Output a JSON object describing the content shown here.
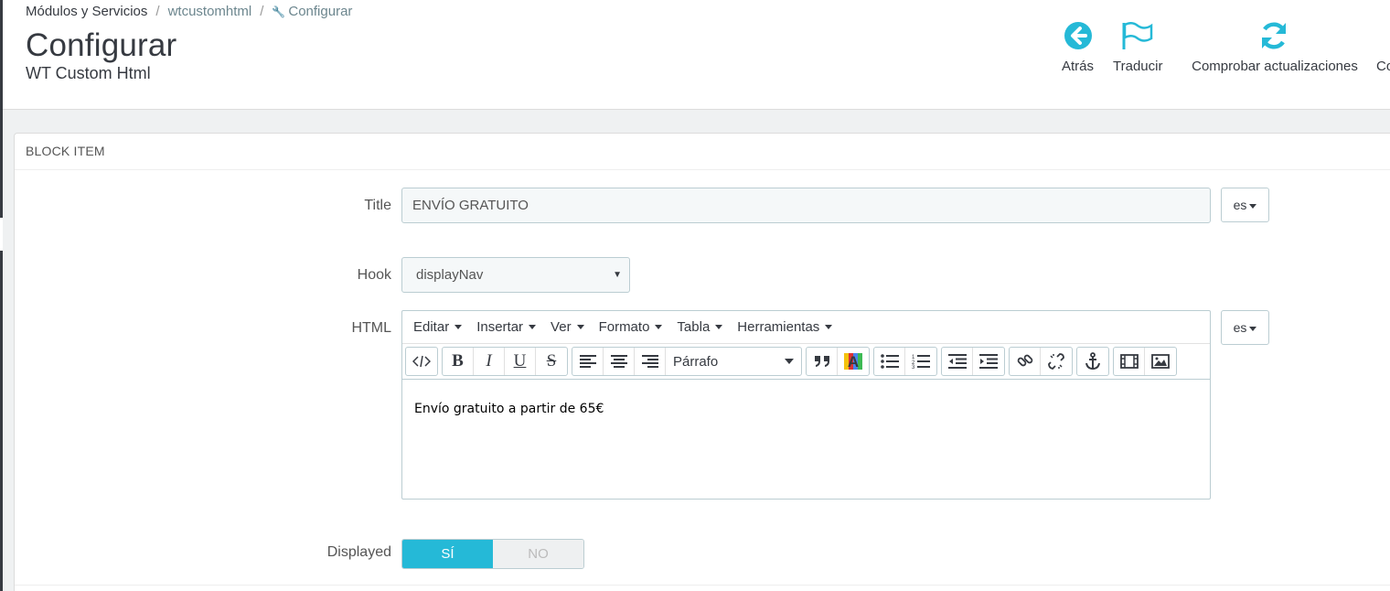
{
  "breadcrumb": {
    "item1": "Módulos y Servicios",
    "item2": "wtcustomhtml",
    "current": "Configurar",
    "separator": "/"
  },
  "header": {
    "title": "Configurar",
    "subtitle": "WT Custom Html"
  },
  "toolbar": {
    "back_label": "Atrás",
    "translate_label": "Traducir",
    "updates_label": "Comprobar actualizaciones",
    "more_label": "Co",
    "icon_color": "#25b9d7"
  },
  "panel": {
    "heading": "BLOCK ITEM"
  },
  "form": {
    "title_label": "Title",
    "title_value": "ENVÍO GRATUITO",
    "lang_1": "es",
    "hook_label": "Hook",
    "hook_value": "displayNav",
    "html_label": "HTML",
    "lang_2": "es",
    "displayed_label": "Displayed",
    "displayed_yes": "SÍ",
    "displayed_no": "NO"
  },
  "editor": {
    "menus": [
      "Editar",
      "Insertar",
      "Ver",
      "Formato",
      "Tabla",
      "Herramientas"
    ],
    "format_value": "Párrafo",
    "content": "Envío gratuito a partir de 65€"
  },
  "colors": {
    "accent": "#25b9d7",
    "sidebar": "#363a41"
  }
}
